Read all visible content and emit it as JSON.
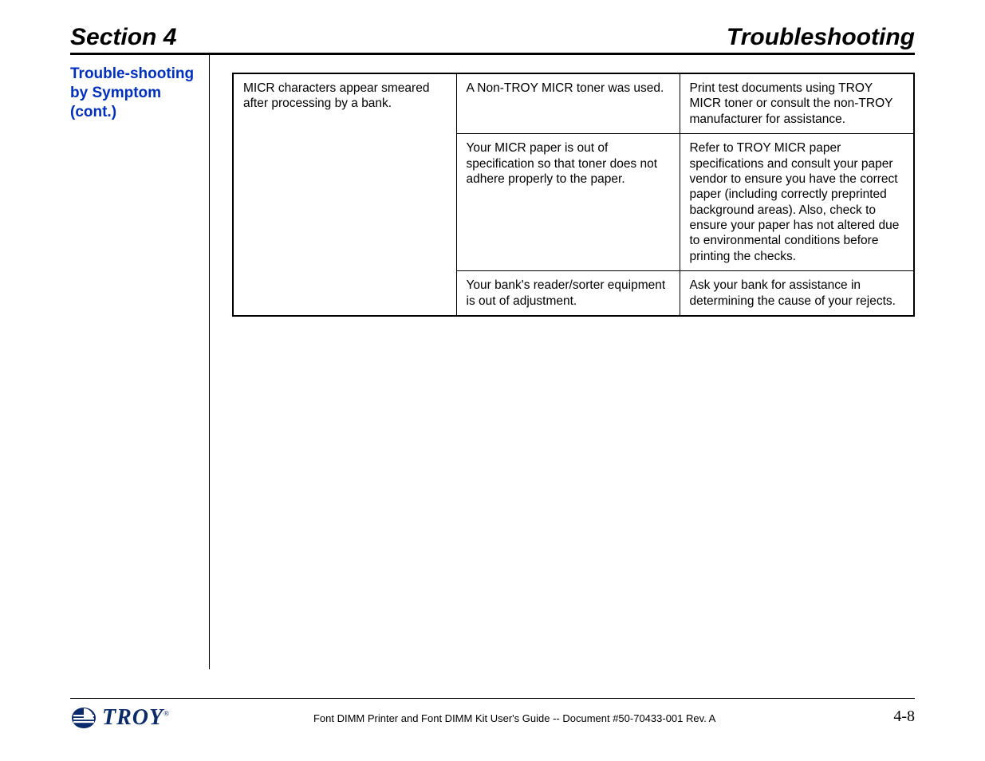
{
  "header": {
    "left": "Section 4",
    "right": "Troubleshooting"
  },
  "sidebar": {
    "heading": "Trouble-shooting by Symptom (cont.)"
  },
  "table": {
    "rows": [
      {
        "symptom": "MICR characters appear smeared after processing by a bank.",
        "cause": "A Non-TROY MICR toner was used.",
        "solution": "Print test documents using TROY MICR toner or consult the non-TROY manufacturer for assistance."
      },
      {
        "symptom": "",
        "cause": "Your MICR paper is out of specification so that toner does not adhere properly to the paper.",
        "solution": "Refer to TROY MICR paper specifications and consult your paper vendor to ensure you have the correct paper (including correctly preprinted background areas).  Also, check to ensure your paper has not altered due to environmental conditions before printing the checks."
      },
      {
        "symptom": "",
        "cause": "Your bank's reader/sorter equipment is out of adjustment.",
        "solution": "Ask your bank for assistance in determining the cause of your rejects."
      }
    ]
  },
  "footer": {
    "doc": "Font DIMM Printer and Font DIMM Kit User's Guide -- Document #50-70433-001  Rev. A",
    "page": "4-8",
    "logo_text": "TROY",
    "logo_reg": "®"
  }
}
